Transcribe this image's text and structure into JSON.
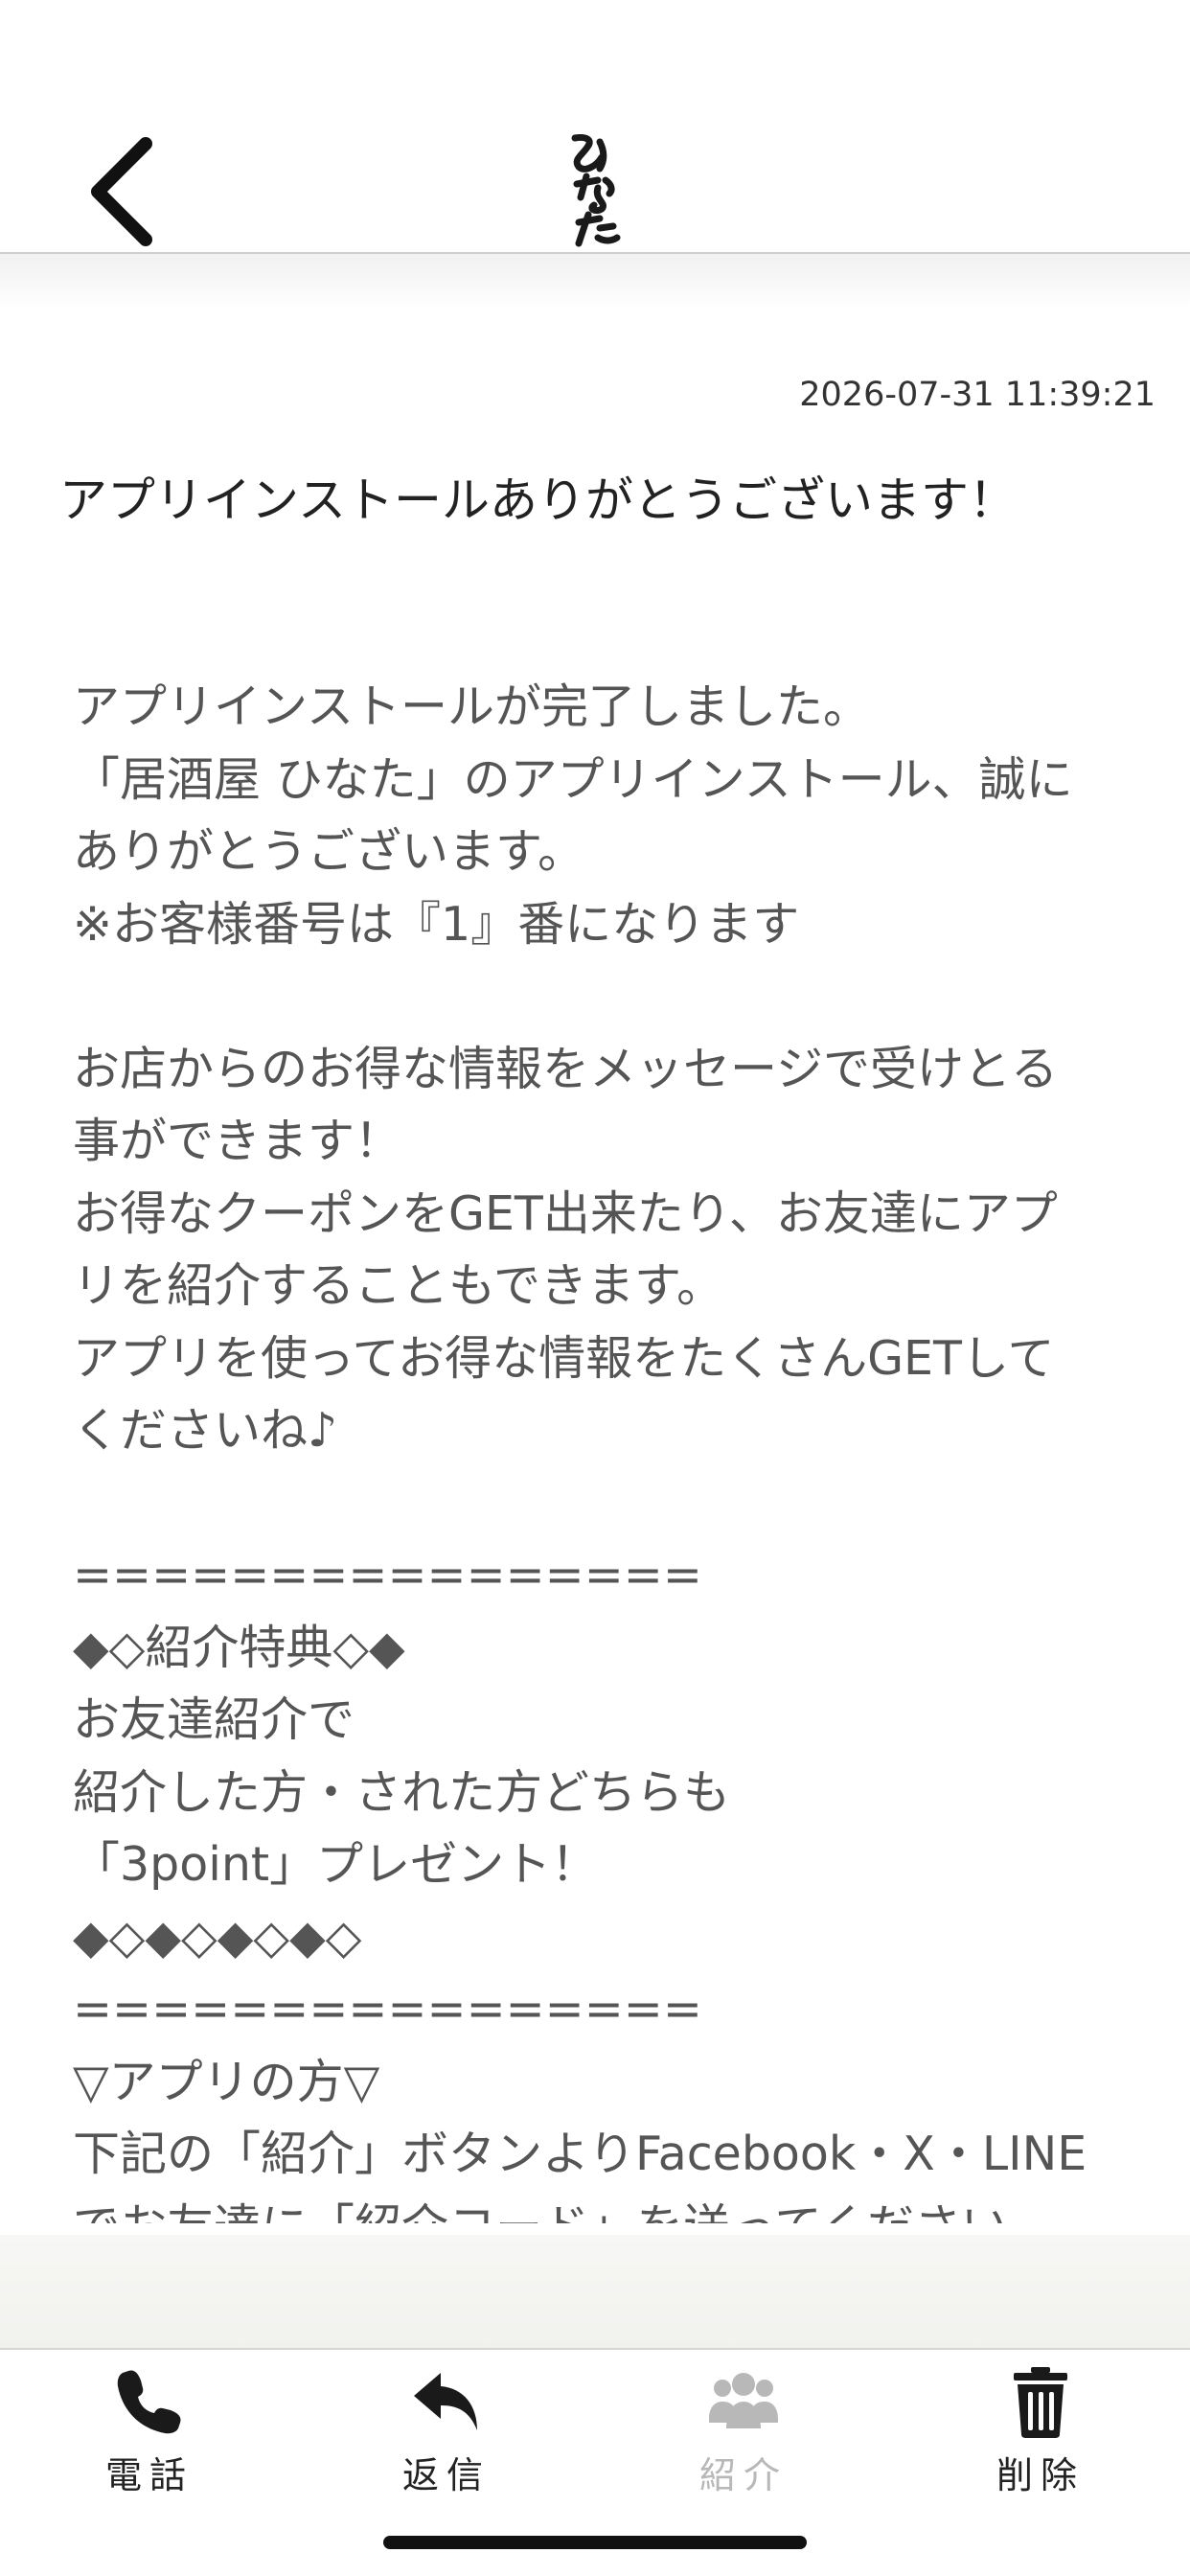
{
  "header": {
    "back_icon": "chevron-left-icon",
    "logo_text": "ひなた"
  },
  "message": {
    "timestamp": "2026-07-31 11:39:21",
    "title": "アプリインストールありがとうございます！",
    "body": "アプリインストールが完了しました。\n「居酒屋 ひなた」のアプリインストール、誠に\nありがとうございます。\n※お客様番号は『1』番になります\n\nお店からのお得な情報をメッセージで受けとる\n事ができます！\nお得なクーポンをGET出来たり、お友達にアプ\nリを紹介することもできます。\nアプリを使ってお得な情報をたくさんGETして\nくださいね♪\n\n================\n◆◇紹介特典◇◆\nお友達紹介で\n紹介した方・された方どちらも\n「3point」プレゼント！\n◆◇◆◇◆◇◆◇\n================\n▽アプリの方▽\n下記の「紹介」ボタンよりFacebook・X・LINE\nでお友達に「紹介コード」を送ってください"
  },
  "toolbar": {
    "items": [
      {
        "label": "電話",
        "icon": "phone-icon",
        "enabled": true
      },
      {
        "label": "返信",
        "icon": "reply-icon",
        "enabled": true
      },
      {
        "label": "紹介",
        "icon": "users-icon",
        "enabled": false
      },
      {
        "label": "削除",
        "icon": "trash-icon",
        "enabled": true
      }
    ]
  },
  "colors": {
    "text": "#333333",
    "disabled": "#b8b8b8",
    "divider": "#cfcfcf"
  }
}
